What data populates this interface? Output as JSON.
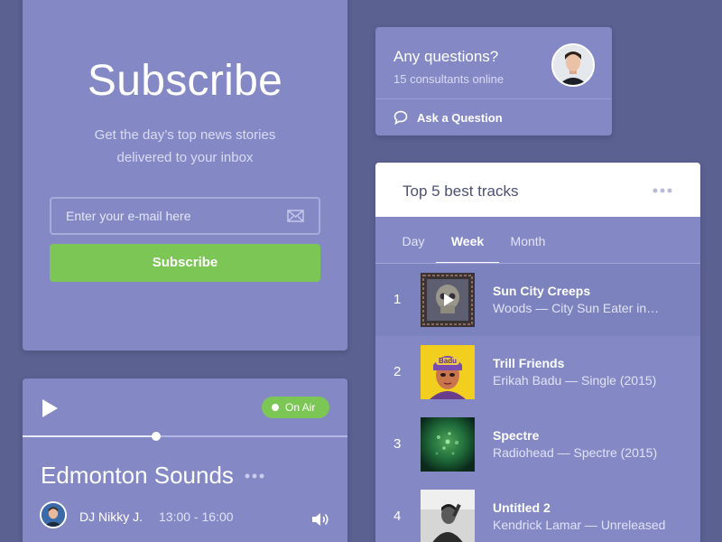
{
  "subscribe": {
    "title": "Subscribe",
    "subtitle_line1": "Get the day’s top news stories",
    "subtitle_line2": "delivered to your inbox",
    "email_placeholder": "Enter your e-mail here",
    "button_label": "Subscribe",
    "mail_icon": "envelope-icon",
    "button_color": "#7cc656"
  },
  "player": {
    "play_icon": "play-icon",
    "status_label": "On Air",
    "status_color": "#7cc656",
    "progress": 0.41,
    "station": "Edmonton Sounds",
    "more_icon": "more-dots-icon",
    "dj_name": "DJ Nikky J.",
    "show_time": "13:00 - 16:00",
    "volume_icon": "volume-icon"
  },
  "questions": {
    "title": "Any questions?",
    "subtitle": "15 consultants online",
    "action_label": "Ask a Question",
    "action_icon": "chat-bubble-icon"
  },
  "tracks": {
    "title": "Top 5 best tracks",
    "more_icon": "more-dots-icon",
    "tabs": [
      {
        "label": "Day",
        "active": false
      },
      {
        "label": "Week",
        "active": true
      },
      {
        "label": "Month",
        "active": false
      }
    ],
    "items": [
      {
        "rank": "1",
        "title": "Sun City Creeps",
        "meta": "Woods — City Sun Eater in…",
        "selected": true,
        "overlay_icon": "play-icon"
      },
      {
        "rank": "2",
        "title": "Trill Friends",
        "meta": "Erikah Badu — Single (2015)",
        "selected": false,
        "cover_text": "Badu"
      },
      {
        "rank": "3",
        "title": "Spectre",
        "meta": "Radiohead — Spectre (2015)",
        "selected": false
      },
      {
        "rank": "4",
        "title": "Untitled 2",
        "meta": "Kendrick Lamar — Unreleased",
        "selected": false
      }
    ]
  },
  "colors": {
    "background": "#5b6190",
    "card": "#8489c6",
    "accent_green": "#7cc656",
    "header_text": "#4d5176"
  }
}
